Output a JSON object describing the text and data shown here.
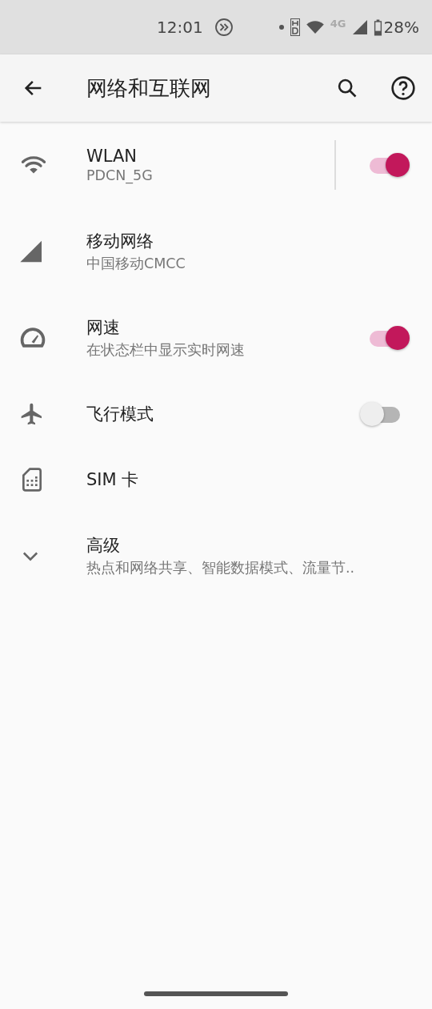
{
  "status_bar": {
    "time": "12:01",
    "network_type": "4G",
    "battery": "28%"
  },
  "app_bar": {
    "title": "网络和互联网"
  },
  "items": [
    {
      "kind": "split-toggle",
      "title": "WLAN",
      "subtitle": "PDCN_5G",
      "on": true
    },
    {
      "kind": "plain",
      "title": "移动网络",
      "subtitle": "中国移动CMCC"
    },
    {
      "kind": "toggle",
      "title": "网速",
      "subtitle": "在状态栏中显示实时网速",
      "on": true
    },
    {
      "kind": "toggle",
      "title": "飞行模式",
      "on": false
    },
    {
      "kind": "plain",
      "title": "SIM 卡"
    },
    {
      "kind": "expand",
      "title": "高级",
      "subtitle": "热点和网络共享、智能数据模式、流量节.."
    }
  ]
}
